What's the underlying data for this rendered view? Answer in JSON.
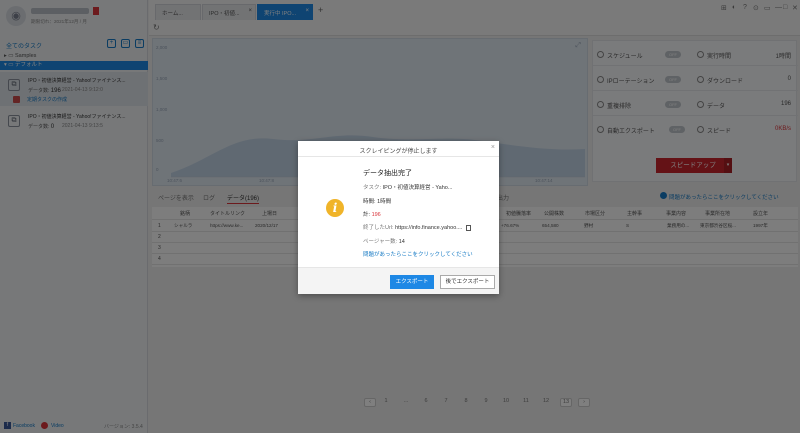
{
  "account": {
    "badge": "",
    "info": "期限切れ：2021年12月 / 月",
    "avatar_glyph": "◉"
  },
  "sidebar": {
    "title": "全てのタスク",
    "icons": [
      "add-task-icon",
      "new-folder-icon",
      "import-icon"
    ],
    "samples_label": "Samples",
    "default_label": "デフォルト",
    "tasks": [
      {
        "name": "IPO・初値決算経営 - Yahoo!ファイナンス...",
        "count_label": "データ数:",
        "count": "196",
        "time": "2021-04-13 9:12:0",
        "schedule": "定期タスクの作成"
      },
      {
        "name": "IPO・初値決算経営 - Yahoo!ファイナンス...",
        "count_label": "データ数:",
        "count": "0",
        "time": "2021-04-13 9:13:5",
        "schedule": ""
      }
    ],
    "footer": {
      "facebook": "Facebook",
      "youtube": "Video",
      "version": "バージョン: 3.5.4"
    }
  },
  "topbar": {
    "tabs": [
      {
        "label": "ホーム..."
      },
      {
        "label": "IPO・初値..."
      },
      {
        "label": "実行中 IPO..."
      }
    ],
    "add_label": "+",
    "refresh_glyph": "↻",
    "window_controls": [
      "⊞",
      "◐",
      "?",
      "⊙",
      "▭",
      "—",
      "□",
      "✕"
    ]
  },
  "chart_axis": {
    "y_ticks": [
      "2,000",
      "1,500",
      "1,000",
      "500",
      "0"
    ],
    "x_ticks": [
      "10:47:6",
      "10:47:8",
      "10:47:10",
      "10:47:12",
      "10:47:14"
    ]
  },
  "stats": {
    "left": [
      {
        "label": "スケジュール",
        "toggle": "OFF"
      },
      {
        "label": "IPローテーション",
        "toggle": "OFF"
      },
      {
        "label": "重複排除",
        "toggle": "OFF"
      },
      {
        "label": "自動エクスポート",
        "toggle": "OFF"
      }
    ],
    "right": [
      {
        "label": "実行時間",
        "value": "1時間"
      },
      {
        "label": "ダウンロード",
        "value": "0"
      },
      {
        "label": "データ",
        "value": "196"
      },
      {
        "label": "スピード",
        "value": "0KB/s"
      }
    ],
    "speedup_label": "スピードアップ",
    "speedup_arrow": "▾"
  },
  "subtabs": {
    "items": [
      "ページを表示",
      "ログ",
      "データ(196)"
    ],
    "right_label": "出力",
    "help": "問題があったらここをクリックしてください"
  },
  "table": {
    "headers": [
      "銘柄",
      "タイトルリンク",
      "上場日",
      "",
      "",
      "",
      "",
      "",
      "",
      "",
      "",
      "",
      "初値騰落率",
      "公開株数",
      "市場区分",
      "主幹事",
      "事業内容",
      "事業所在地",
      "設立年"
    ],
    "rows": [
      {
        "n": "1",
        "cells": [
          "シャルラ",
          "https://www.ke...",
          "2020/12/17",
          "",
          "",
          "",
          "",
          "",
          "",
          "",
          "",
          "",
          "+76.67%",
          "654,580",
          "野村",
          "S",
          "業務用の...",
          "東京都渋谷区桜...",
          "1997年"
        ]
      },
      {
        "n": "2",
        "cells": []
      },
      {
        "n": "3",
        "cells": []
      },
      {
        "n": "4",
        "cells": []
      }
    ]
  },
  "pager": {
    "pages": [
      "‹",
      "1",
      "...",
      "6",
      "7",
      "8",
      "9",
      "10",
      "11",
      "12",
      "13",
      "›"
    ]
  },
  "modal": {
    "title": "スクレイピングが停止します",
    "close": "×",
    "heading": "データ抽出完了",
    "task_label": "タスク:",
    "task_value": "IPO・初値決算経営 - Yaho...",
    "time_label": "時間:",
    "time_value": "1時間",
    "count_label": "計:",
    "count_value": "196",
    "url_label": "終了したUrl:",
    "url_value": "https://info.finance.yahoo....",
    "pages_label": "ページャー数:",
    "pages_value": "14",
    "help_link": "問題があったらここをクリックしてください",
    "export_btn": "エクスポート",
    "later_btn": "後でエクスポート"
  }
}
